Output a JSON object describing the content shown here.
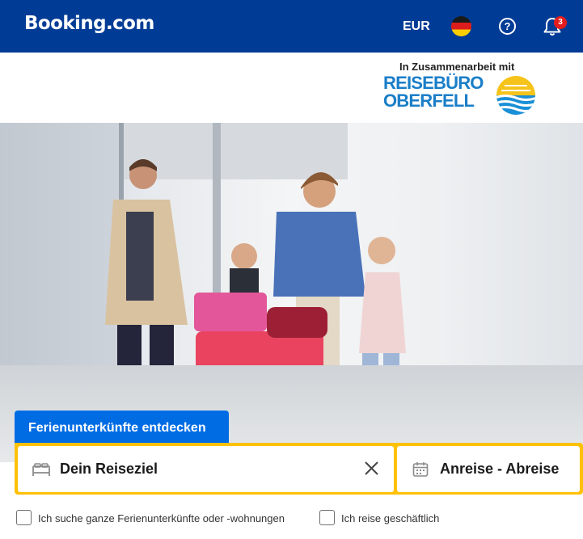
{
  "header": {
    "logo": "Booking.com",
    "currency": "EUR",
    "flag_icon": "germany-flag-icon",
    "help_icon": "question-circle-icon",
    "notifications_icon": "bell-icon",
    "notifications_count": "3",
    "help_glyph": "?"
  },
  "partner": {
    "text": "In Zusammenarbeit mit",
    "logo_line1": "REISEBÜRO",
    "logo_line2": "OBERFELL"
  },
  "search": {
    "tab_label": "Ferienunterkünfte entdecken",
    "destination_label": "Dein Reiseziel",
    "dates_label": "Anreise - Abreise",
    "bed_icon": "bed-icon",
    "clear_icon": "close-icon",
    "calendar_icon": "calendar-icon"
  },
  "options": {
    "whole_homes_label": "Ich suche ganze Ferienunterkünfte oder -wohnungen",
    "business_label": "Ich reise geschäftlich"
  },
  "colors": {
    "brand_blue": "#003b95",
    "tab_blue": "#006ce4",
    "search_border": "#ffc107"
  }
}
